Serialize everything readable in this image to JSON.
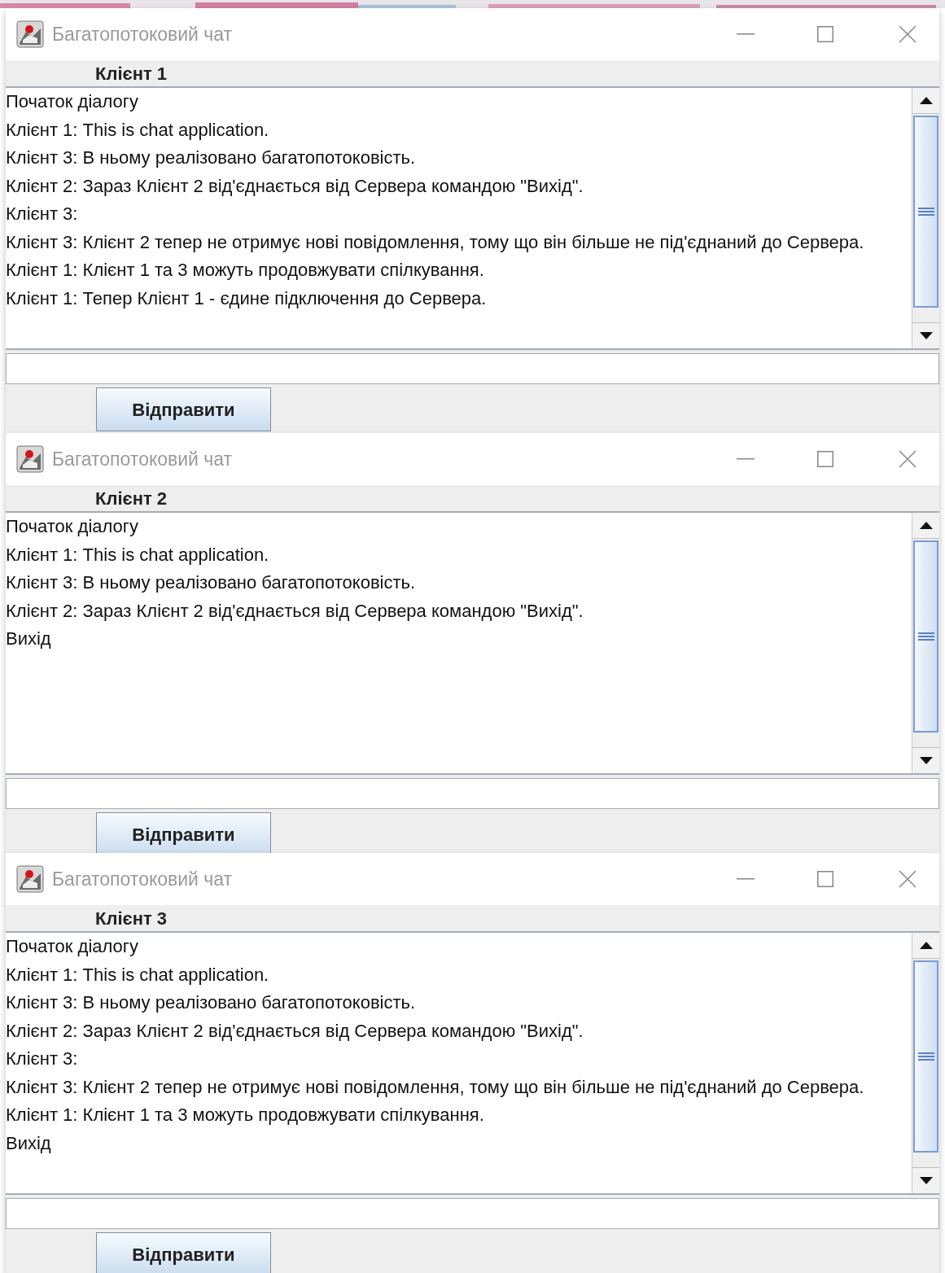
{
  "windows": [
    {
      "title": "Багатопотоковий чат",
      "client_label": "Клієнт 1",
      "messages": [
        "Початок діалогу",
        "Клієнт 1: This is chat application.",
        "Клієнт 3: В ньому реалізовано багатопотоковість.",
        "Клієнт 2: Зараз Клієнт 2 від'єднається від Сервера командою \"Вихід\".",
        "Клієнт 3:",
        "Клієнт 3: Клієнт 2 тепер не отримує нові повідомлення, тому що він більше не під'єднаний до Сервера.",
        "Клієнт 1: Клієнт 1 та 3 можуть продовжувати спілкування.",
        "Клієнт 1: Тепер Клієнт 1 - єдине підключення до Сервера."
      ],
      "send_button": "Відправити"
    },
    {
      "title": "Багатопотоковий чат",
      "client_label": "Клієнт 2",
      "messages": [
        "Початок діалогу",
        "Клієнт 1: This is chat application.",
        "Клієнт 3: В ньому реалізовано багатопотоковість.",
        "Клієнт 2: Зараз Клієнт 2 від'єднається від Сервера командою \"Вихід\".",
        "Вихід"
      ],
      "send_button": "Відправити"
    },
    {
      "title": "Багатопотоковий чат",
      "client_label": "Клієнт 3",
      "messages": [
        "Початок діалогу",
        "Клієнт 1: This is chat application.",
        "Клієнт 3: В ньому реалізовано багатопотоковість.",
        "Клієнт 2: Зараз Клієнт 2 від'єднається від Сервера командою \"Вихід\".",
        "Клієнт 3:",
        "Клієнт 3: Клієнт 2 тепер не отримує нові повідомлення, тому що він більше не під'єднаний до Сервера.",
        "Клієнт 1: Клієнт 1 та 3 можуть продовжувати спілкування.",
        "Вихід"
      ],
      "send_button": "Відправити"
    }
  ]
}
